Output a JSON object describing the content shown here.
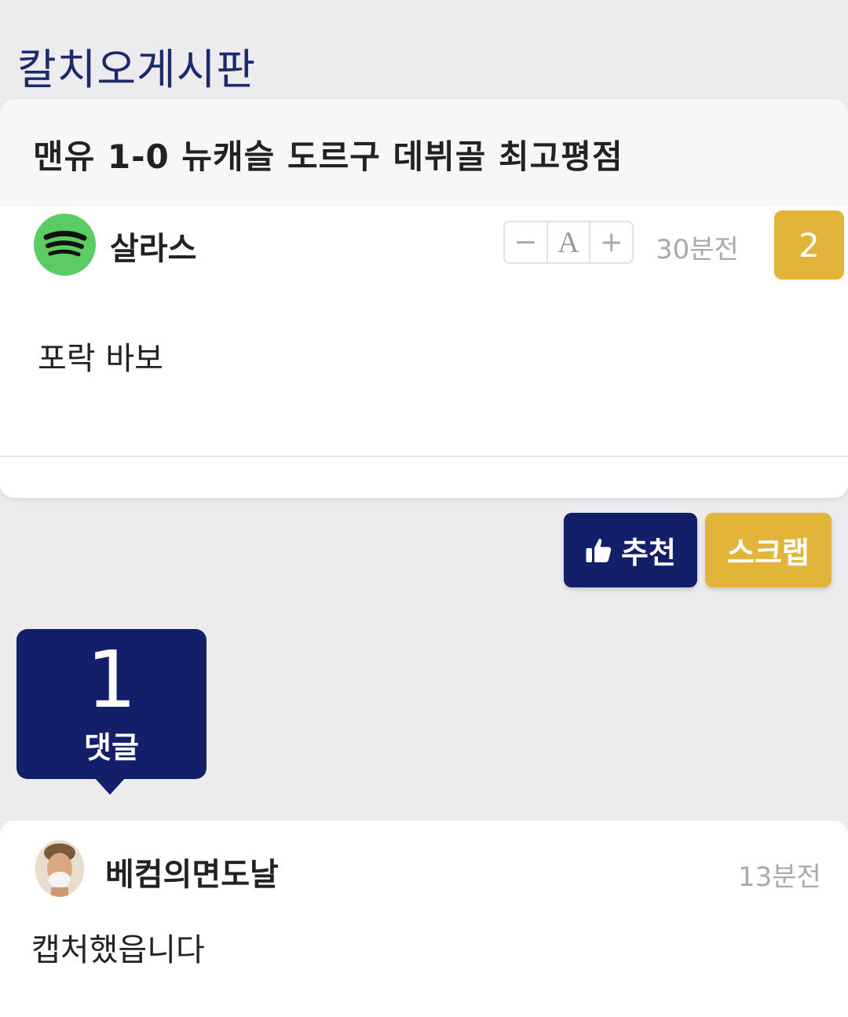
{
  "board": {
    "title": "칼치오게시판"
  },
  "post": {
    "title": "맨유 1-0 뉴캐슬 도르구 데뷔골 최고평점",
    "author": {
      "name": "살라스",
      "avatar_icon": "spotify-logo-icon"
    },
    "font_controls": {
      "decrease": "−",
      "font": "A",
      "increase": "+"
    },
    "time": "30분전",
    "recommend_count": "2",
    "body": "포락 바보"
  },
  "actions": {
    "recommend_label": "추천",
    "recommend_icon": "thumbs-up-icon",
    "scrap_label": "스크랩"
  },
  "comments": {
    "count": "1",
    "count_label": "댓글",
    "items": [
      {
        "author": "베컴의면도날",
        "time": "13분전",
        "text": "캡처했읍니다"
      }
    ]
  },
  "colors": {
    "navy": "#141f6a",
    "gold": "#e2b43a",
    "title_blue": "#1c2a6b",
    "background": "#ececee"
  }
}
